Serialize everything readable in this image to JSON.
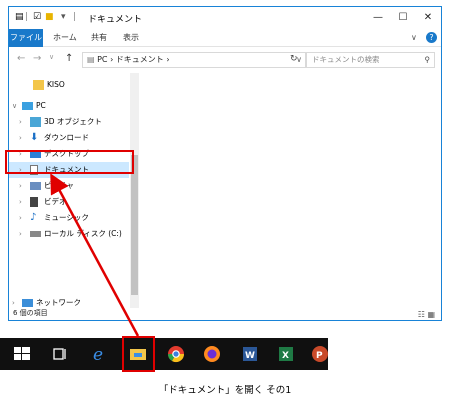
{
  "window": {
    "title": "ドキュメント",
    "minimize": "—",
    "maximize": "☐",
    "close": "✕"
  },
  "ribbon": {
    "tabs": [
      "ファイル",
      "ホーム",
      "共有",
      "表示"
    ],
    "help": "?"
  },
  "address": {
    "path": "PC › ドキュメント ›",
    "search_placeholder": "ドキュメントの検索"
  },
  "nav": {
    "items": [
      {
        "label": "KISO",
        "icon": "folder-icon"
      },
      {
        "label": "PC",
        "icon": "computer-icon"
      },
      {
        "label": "3D オブジェクト",
        "icon": "3d-objects-icon"
      },
      {
        "label": "ダウンロード",
        "icon": "download-icon"
      },
      {
        "label": "デスクトップ",
        "icon": "desktop-icon"
      },
      {
        "label": "ドキュメント",
        "icon": "documents-icon"
      },
      {
        "label": "ピクチャ",
        "icon": "pictures-icon"
      },
      {
        "label": "ビデオ",
        "icon": "videos-icon"
      },
      {
        "label": "ミュージック",
        "icon": "music-icon"
      },
      {
        "label": "ローカル ディスク (C:)",
        "icon": "disk-icon"
      },
      {
        "label": "ネットワーク",
        "icon": "network-icon"
      }
    ]
  },
  "status": {
    "count": "6 個の項目"
  },
  "caption": "「ドキュメント」を開く その1",
  "colors": {
    "accent": "#1979ca",
    "highlight": "#e00000",
    "selection": "#cce8ff"
  }
}
